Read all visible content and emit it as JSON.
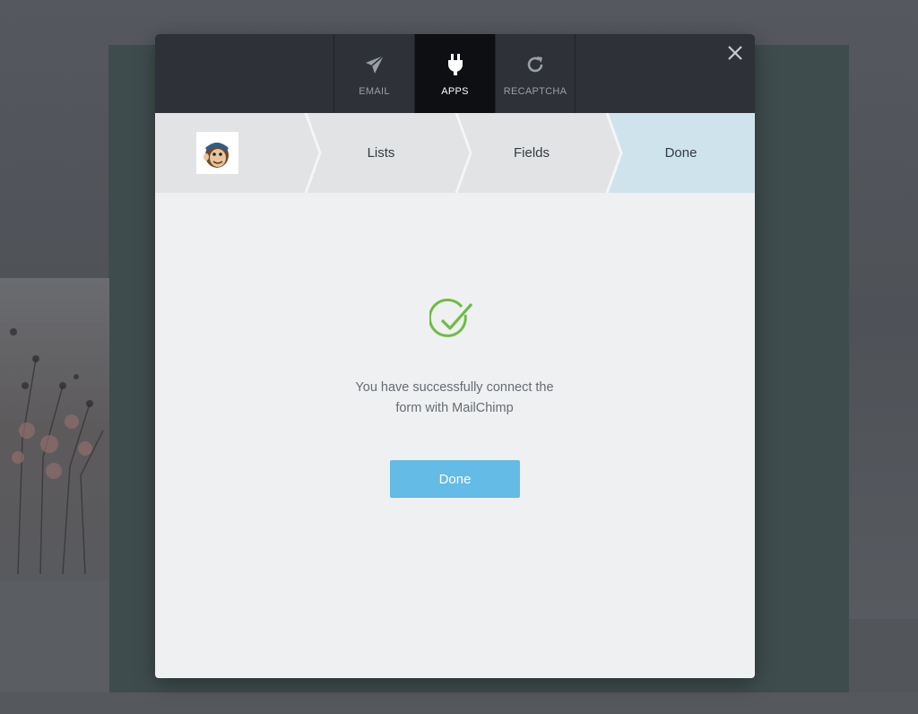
{
  "header": {
    "tabs": [
      {
        "label": "EMAIL",
        "icon": "paper-plane-icon",
        "active": false
      },
      {
        "label": "APPS",
        "icon": "plug-icon",
        "active": true
      },
      {
        "label": "RECAPTCHA",
        "icon": "refresh-icon",
        "active": false
      }
    ],
    "close_icon": "close-icon"
  },
  "steps": {
    "items": [
      {
        "label": "",
        "icon": "mailchimp-logo"
      },
      {
        "label": "Lists"
      },
      {
        "label": "Fields"
      },
      {
        "label": "Done",
        "active": true
      }
    ],
    "active_color": "#cfe3ed"
  },
  "content": {
    "check_icon": "check-circle-icon",
    "check_color": "#6dbd45",
    "message_line1": "You have successfully connect the",
    "message_line2": "form with MailChimp",
    "done_button": "Done",
    "button_color": "#63bbe6"
  }
}
